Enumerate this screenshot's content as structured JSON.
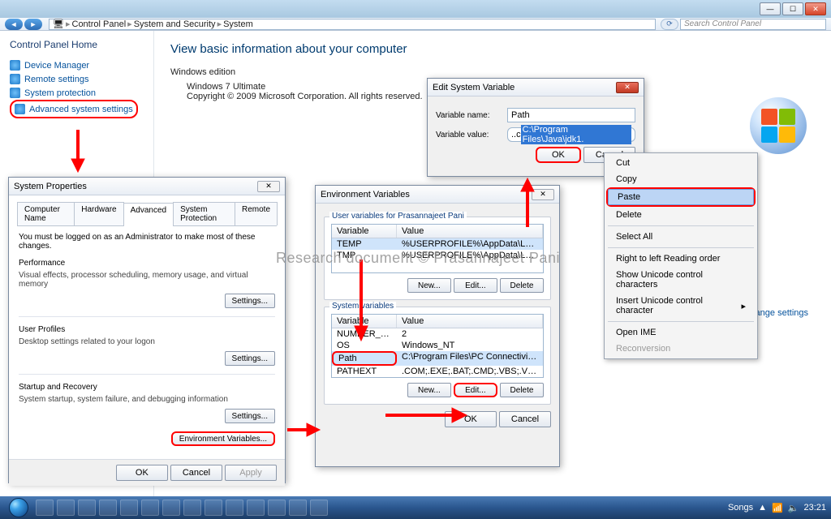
{
  "titlebar": {
    "min": "—",
    "max": "☐",
    "close": "✕"
  },
  "breadcrumb": {
    "root_icon": "🖥",
    "items": [
      "Control Panel",
      "System and Security",
      "System"
    ],
    "search_placeholder": "Search Control Panel"
  },
  "sidebar": {
    "home": "Control Panel Home",
    "links": [
      "Device Manager",
      "Remote settings",
      "System protection",
      "Advanced system settings"
    ]
  },
  "main": {
    "heading": "View basic information about your computer",
    "edition_label": "Windows edition",
    "edition_name": "Windows 7 Ultimate",
    "copyright": "Copyright © 2009 Microsoft Corporation.  All rights reserved.",
    "change_settings": "Change settings"
  },
  "sysprops": {
    "title": "System Properties",
    "tabs": [
      "Computer Name",
      "Hardware",
      "Advanced",
      "System Protection",
      "Remote"
    ],
    "note": "You must be logged on as an Administrator to make most of these changes.",
    "perf_label": "Performance",
    "perf_text": "Visual effects, processor scheduling, memory usage, and virtual memory",
    "profiles_label": "User Profiles",
    "profiles_text": "Desktop settings related to your logon",
    "startup_label": "Startup and Recovery",
    "startup_text": "System startup, system failure, and debugging information",
    "settings_btn": "Settings...",
    "envvars_btn": "Environment Variables...",
    "ok": "OK",
    "cancel": "Cancel",
    "apply": "Apply"
  },
  "envdlg": {
    "title": "Environment Variables",
    "user_group": "User variables for Prasannajeet Pani",
    "sys_group": "System variables",
    "col_var": "Variable",
    "col_val": "Value",
    "user_rows": [
      {
        "v": "TEMP",
        "val": "%USERPROFILE%\\AppData\\Local\\Temp"
      },
      {
        "v": "TMP",
        "val": "%USERPROFILE%\\AppData\\Local\\Temp"
      }
    ],
    "sys_rows": [
      {
        "v": "NUMBER_OF_P...",
        "val": "2"
      },
      {
        "v": "OS",
        "val": "Windows_NT"
      },
      {
        "v": "Path",
        "val": "C:\\Program Files\\PC Connectivity Soluti..."
      },
      {
        "v": "PATHEXT",
        "val": ".COM;.EXE;.BAT;.CMD;.VBS;.VBE;.JS;..."
      }
    ],
    "new": "New...",
    "edit": "Edit...",
    "delete": "Delete",
    "ok": "OK",
    "cancel": "Cancel"
  },
  "editvar": {
    "title": "Edit System Variable",
    "name_label": "Variable name:",
    "name_value": "Path",
    "value_label": "Variable value:",
    "value_prefix": "..c",
    "value_selected": "C:\\Program Files\\Java\\jdk1.",
    "ok": "OK",
    "cancel": "Cancel"
  },
  "ctx": {
    "items_top": [
      "Cut",
      "Copy",
      "Paste",
      "Delete"
    ],
    "select_all": "Select All",
    "rtl": "Right to left Reading order",
    "show_unicode": "Show Unicode control characters",
    "insert_unicode": "Insert Unicode control character",
    "open_ime": "Open IME",
    "reconversion": "Reconversion"
  },
  "watermark": "Research document © Prasannajeet Pani",
  "taskbar": {
    "tray_label": "Songs",
    "clock": "23:21",
    "tray_icons": [
      "▲",
      "🔈",
      "📶"
    ]
  }
}
